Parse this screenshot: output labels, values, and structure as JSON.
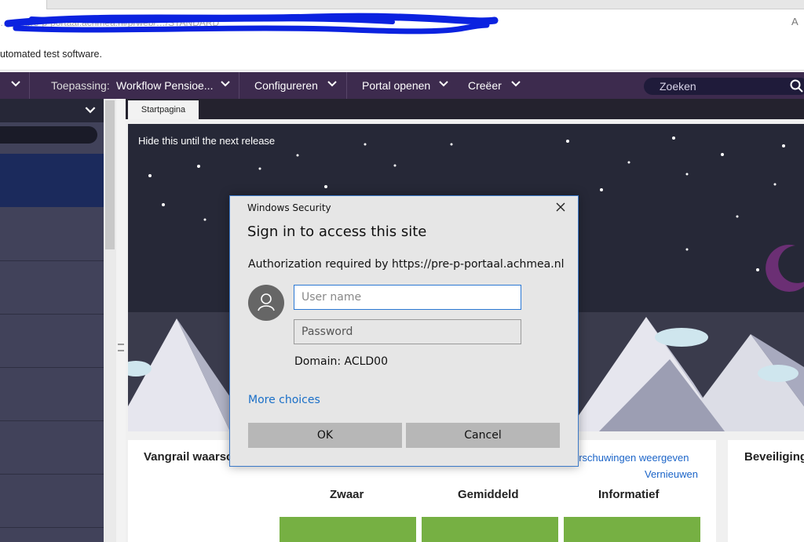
{
  "browser": {
    "address_text": "…tp://pre-p-portaal.achmea.nl/prweb/…/STANDARD",
    "infobar_text": "utomated test software."
  },
  "nav": {
    "toepassing_label": "Toepassing:",
    "toepassing_value": "Workflow Pensioe...",
    "configureren": "Configureren",
    "portal_openen": "Portal openen",
    "creeer": "Creëer",
    "search_placeholder": "Zoeken"
  },
  "workspace": {
    "tab_start": "Startpagina",
    "banner_text": "Hide this until the next release",
    "card1": {
      "title": "Vangrail waarsc",
      "link_show": "erschuwingen weergeven",
      "link_refresh": "Vernieuwen",
      "columns": [
        "Zwaar",
        "Gemiddeld",
        "Informatief"
      ]
    },
    "card2": {
      "title": "Beveiliging"
    }
  },
  "dialog": {
    "caption": "Windows Security",
    "title": "Sign in to access this site",
    "auth_text": "Authorization required by https://pre-p-portaal.achmea.nl",
    "username_placeholder": "User name",
    "password_placeholder": "Password",
    "domain": "Domain: ACLD00",
    "more_choices": "More choices",
    "ok": "OK",
    "cancel": "Cancel"
  },
  "colors": {
    "nav_bg": "#3d2b4e",
    "dialog_accent": "#2b78d4",
    "tile_green": "#76b043",
    "link_blue": "#1b64c8",
    "redaction": "#0b22e0"
  }
}
